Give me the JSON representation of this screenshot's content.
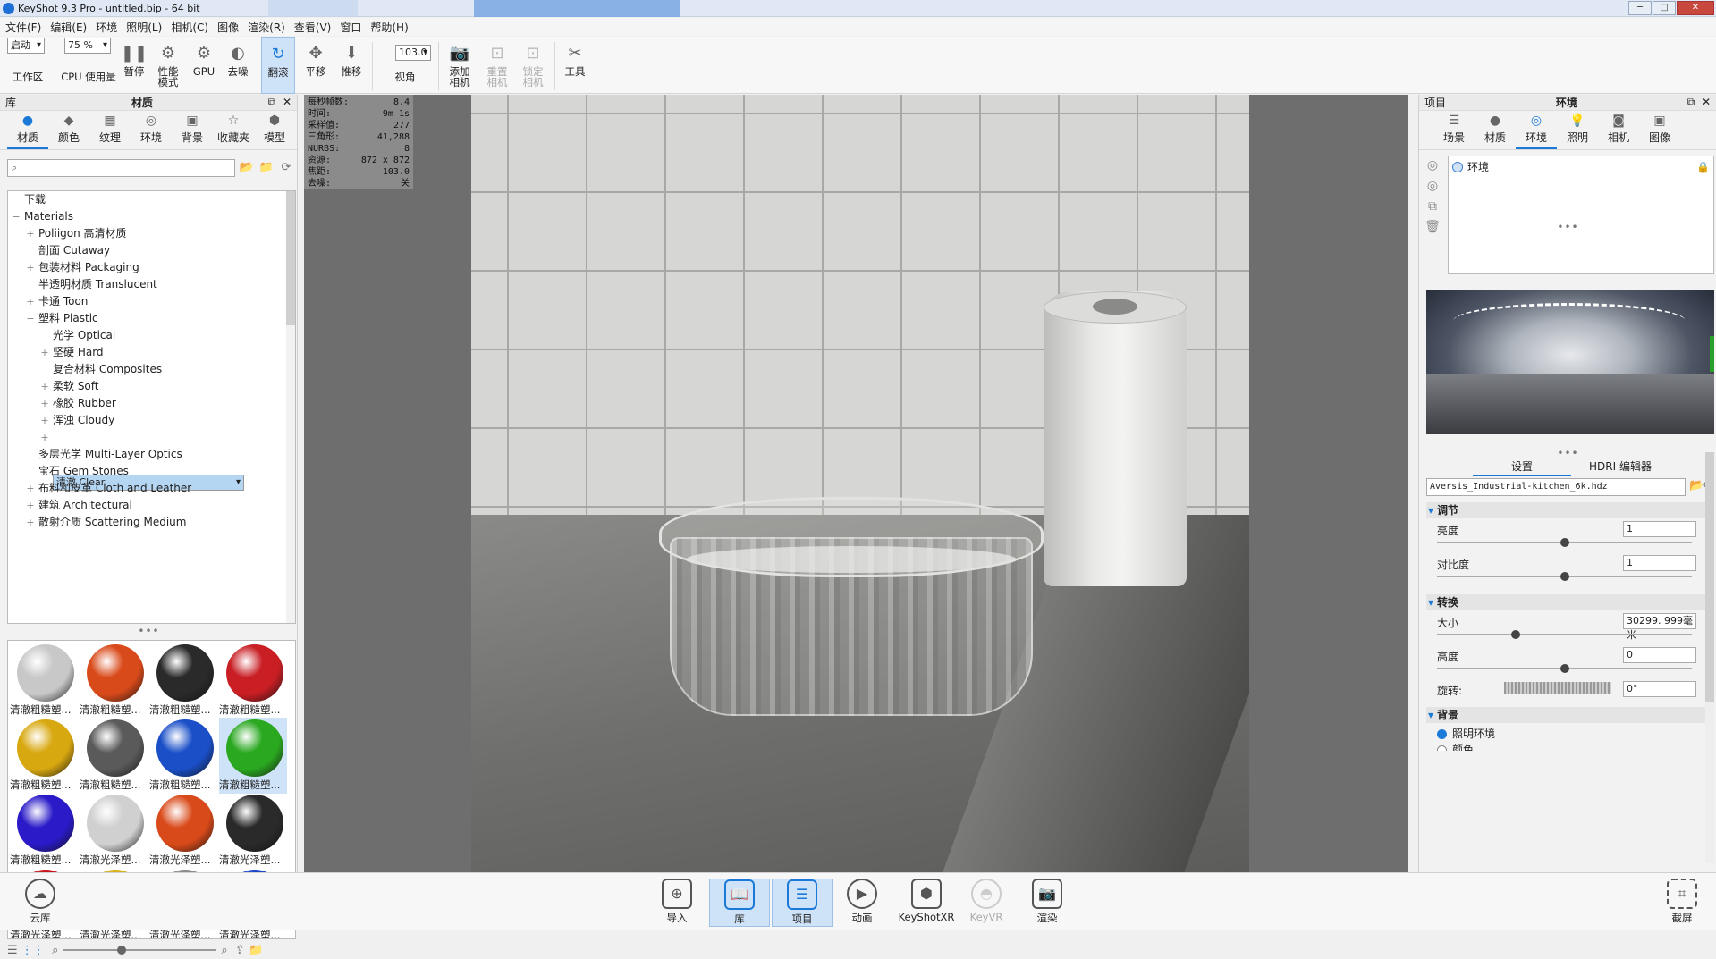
{
  "window": {
    "title": "KeyShot 9.3 Pro  - untitled.bip  - 64 bit",
    "min": "─",
    "max": "□",
    "close": "✕"
  },
  "menu": [
    "文件(F)",
    "编辑(E)",
    "环境",
    "照明(L)",
    "相机(C)",
    "图像",
    "渲染(R)",
    "查看(V)",
    "窗口",
    "帮助(H)"
  ],
  "toolbar": {
    "mode_select": "启动",
    "cpu_select": "75 %",
    "fov_value": "103.0",
    "workspace": "工作区",
    "cpu_usage": "CPU 使用量",
    "pause": "暂停",
    "perf_mode": "性能模式",
    "gpu": "GPU",
    "denoise": "去噪",
    "tumble": "翻滚",
    "pan": "平移",
    "dolly": "推移",
    "fov": "视角",
    "add_camera": "添加相机",
    "reset_camera": "重置相机",
    "lock_camera": "锁定相机",
    "tools": "工具"
  },
  "library": {
    "panel_label": "库",
    "panel_title": "材质",
    "tabs": [
      "材质",
      "颜色",
      "纹理",
      "环境",
      "背景",
      "收藏夹",
      "模型"
    ],
    "active_tab": "材质",
    "search_placeholder": "",
    "tree": [
      {
        "label": "下载",
        "indent": 0,
        "expander": ""
      },
      {
        "label": "Materials",
        "indent": 0,
        "expander": "−"
      },
      {
        "label": "Poliigon 高清材质",
        "indent": 1,
        "expander": "+"
      },
      {
        "label": "剖面 Cutaway",
        "indent": 1,
        "expander": ""
      },
      {
        "label": "包装材料 Packaging",
        "indent": 1,
        "expander": "+"
      },
      {
        "label": "半透明材质 Translucent",
        "indent": 1,
        "expander": ""
      },
      {
        "label": "卡通 Toon",
        "indent": 1,
        "expander": "+"
      },
      {
        "label": "塑料 Plastic",
        "indent": 1,
        "expander": "−"
      },
      {
        "label": "光学 Optical",
        "indent": 2,
        "expander": ""
      },
      {
        "label": "坚硬 Hard",
        "indent": 2,
        "expander": "+"
      },
      {
        "label": "复合材料 Composites",
        "indent": 2,
        "expander": ""
      },
      {
        "label": "柔软 Soft",
        "indent": 2,
        "expander": "+"
      },
      {
        "label": "橡胶 Rubber",
        "indent": 2,
        "expander": "+"
      },
      {
        "label": "浑浊 Cloudy",
        "indent": 2,
        "expander": "+"
      },
      {
        "label": "清澈 Clear",
        "indent": 2,
        "expander": "+",
        "selected": true
      },
      {
        "label": "多层光学 Multi-Layer Optics",
        "indent": 1,
        "expander": ""
      },
      {
        "label": "宝石 Gem Stones",
        "indent": 1,
        "expander": ""
      },
      {
        "label": "布料和皮革 Cloth and Leather",
        "indent": 1,
        "expander": "+"
      },
      {
        "label": "建筑 Architectural",
        "indent": 1,
        "expander": "+"
      },
      {
        "label": "散射介质 Scattering Medium",
        "indent": 1,
        "expander": "+"
      }
    ],
    "thumbnails": [
      {
        "label": "清澈粗糙塑...",
        "color": "#c8c8c8"
      },
      {
        "label": "清澈粗糙塑...",
        "color": "#d94a1a"
      },
      {
        "label": "清澈粗糙塑...",
        "color": "#2a2a2a"
      },
      {
        "label": "清澈粗糙塑...",
        "color": "#c81e24"
      },
      {
        "label": "清澈粗糙塑...",
        "color": "#d8a810"
      },
      {
        "label": "清澈粗糙塑...",
        "color": "#5a5a5a"
      },
      {
        "label": "清澈粗糙塑...",
        "color": "#1a4fc8"
      },
      {
        "label": "清澈粗糙塑...",
        "color": "#2aa820",
        "selected": true
      },
      {
        "label": "清澈粗糙塑...",
        "color": "#2a1ac8"
      },
      {
        "label": "清澈光泽塑...",
        "color": "#d0d0d0"
      },
      {
        "label": "清澈光泽塑...",
        "color": "#d94a1a"
      },
      {
        "label": "清澈光泽塑...",
        "color": "#2a2a2a"
      },
      {
        "label": "清澈光泽塑...",
        "color": "#c8141a"
      },
      {
        "label": "清澈光泽塑...",
        "color": "#d8b018"
      },
      {
        "label": "清澈光泽塑...",
        "color": "#8a8a8a"
      },
      {
        "label": "清澈光泽塑...",
        "color": "#1a48c8"
      }
    ]
  },
  "stats": [
    {
      "k": "每秒帧数:",
      "v": "8.4"
    },
    {
      "k": "时间:",
      "v": "9m 1s"
    },
    {
      "k": "采样值:",
      "v": "277"
    },
    {
      "k": "三角形:",
      "v": "41,288"
    },
    {
      "k": "NURBS:",
      "v": "8"
    },
    {
      "k": "资源:",
      "v": "872 x 872"
    },
    {
      "k": "焦距:",
      "v": "103.0"
    },
    {
      "k": "去噪:",
      "v": "关"
    }
  ],
  "project": {
    "panel_label": "项目",
    "panel_title": "环境",
    "tabs": [
      "场景",
      "材质",
      "环境",
      "照明",
      "相机",
      "图像"
    ],
    "active_tab": "环境",
    "env_item": "环境",
    "subtabs": [
      "设置",
      "HDRI 编辑器"
    ],
    "hdr_file": "Aversis_Industrial-kitchen_6k.hdz",
    "adjust_header": "调节",
    "brightness_label": "亮度",
    "brightness_value": "1",
    "brightness_level": 0.5,
    "contrast_label": "对比度",
    "contrast_value": "1",
    "contrast_level": 0.5,
    "transform_header": "转换",
    "size_label": "大小",
    "size_value": "30299. 999毫米",
    "size_level": 0.3,
    "height_label": "高度",
    "height_value": "0",
    "height_level": 0.5,
    "rotation_label": "旋转:",
    "rotation_value": "0°",
    "background_header": "背景",
    "bg_option1": "照明环境",
    "bg_option2": "颜色"
  },
  "bottombar": {
    "cloud": "云库",
    "import": "导入",
    "library": "库",
    "project": "项目",
    "animation": "动画",
    "keyshotxr": "KeyShotXR",
    "keyvr": "KeyVR",
    "render": "渲染",
    "screenshot": "截屏"
  }
}
